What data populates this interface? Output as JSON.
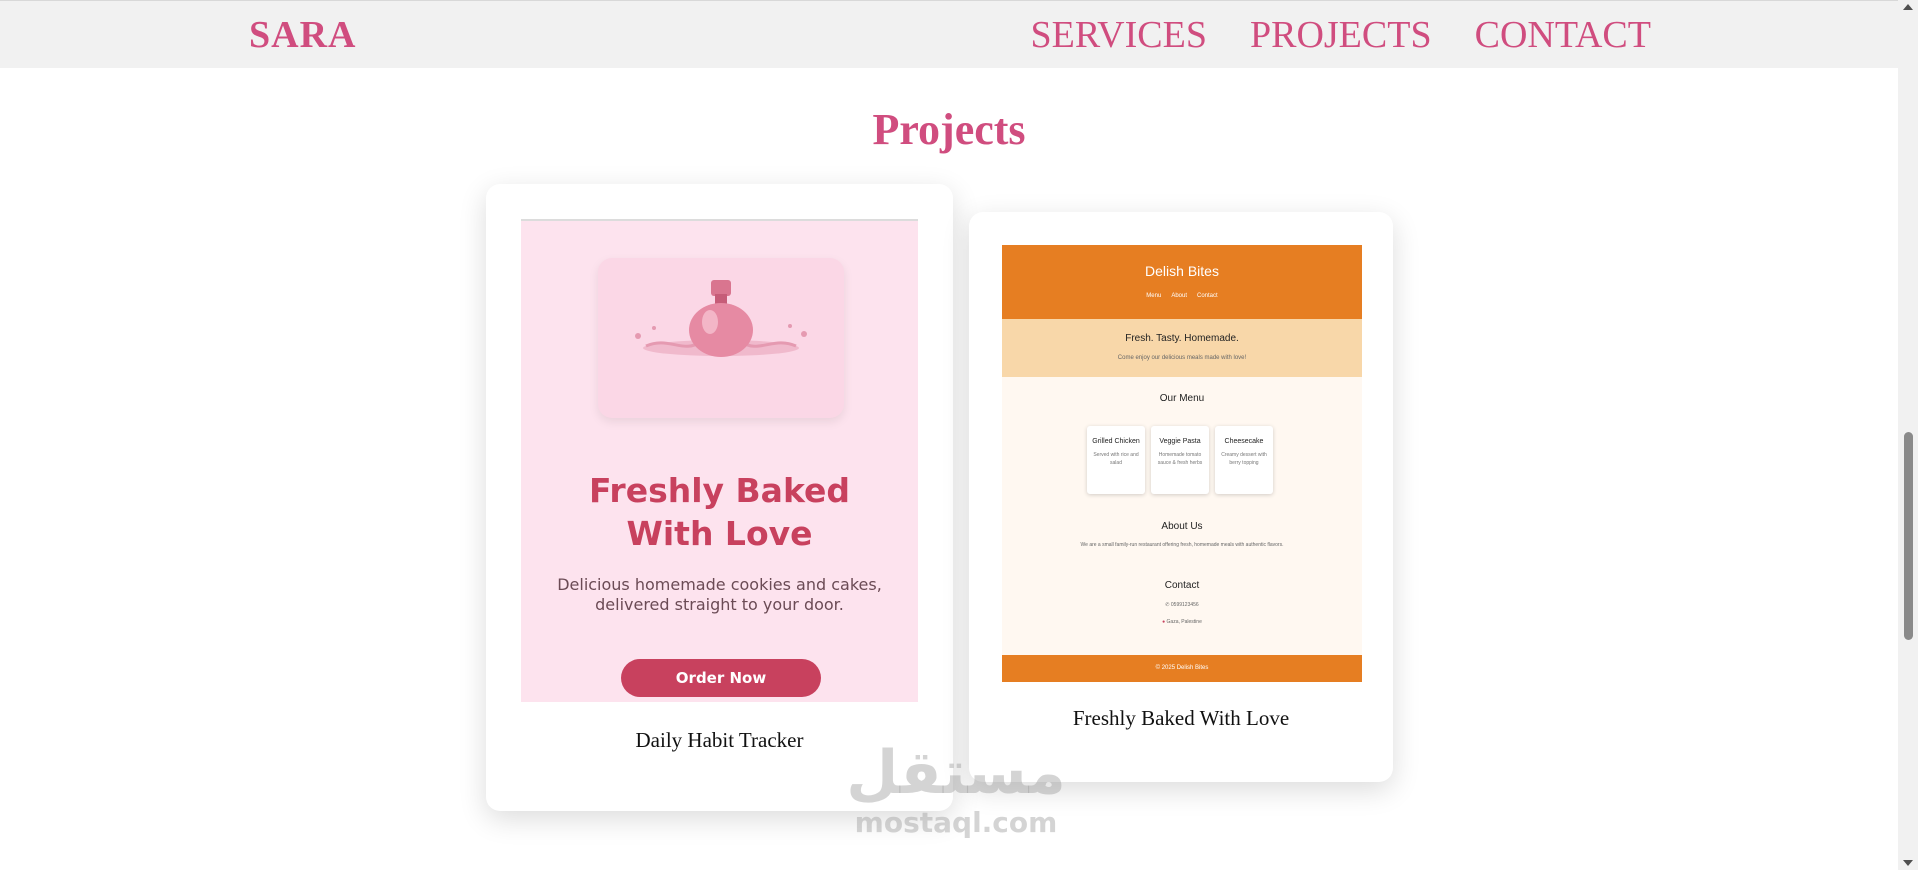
{
  "nav": {
    "brand": "SARA",
    "links": [
      "SERVICES",
      "PROJECTS",
      "CONTACT"
    ]
  },
  "section_title": "Projects",
  "projects": [
    {
      "caption": "Daily Habit Tracker",
      "preview": {
        "hero_title_1": "Freshly Baked",
        "hero_title_2": "With Love",
        "description": "Delicious homemade cookies and cakes, delivered straight to your door.",
        "button": "Order Now"
      }
    },
    {
      "caption": "Freshly Baked With Love",
      "preview": {
        "brand": "Delish Bites",
        "nav": [
          "Menu",
          "About",
          "Contact"
        ],
        "hero_title": "Fresh. Tasty. Homemade.",
        "hero_subtitle": "Come enjoy our delicious meals made with love!",
        "menu_heading": "Our Menu",
        "menu_items": [
          {
            "name": "Grilled Chicken",
            "desc": "Served with rice and salad"
          },
          {
            "name": "Veggie Pasta",
            "desc": "Homemade tomato sauce & fresh herbs"
          },
          {
            "name": "Cheesecake",
            "desc": "Creamy dessert with berry topping"
          }
        ],
        "about_heading": "About Us",
        "about_text": "We are a small family-run restaurant offering fresh, homemade meals with authentic flavors.",
        "contact_heading": "Contact",
        "phone": "0599123456",
        "location": "Gaza, Palestine",
        "footer": "2025 Delish Bites"
      }
    }
  ],
  "watermark": {
    "arabic": "مستقل",
    "latin": "mostaql.com"
  },
  "colors": {
    "accent": "#d04d7f",
    "bakery_pink": "#c8415e",
    "restaurant_orange": "#e67e22"
  }
}
